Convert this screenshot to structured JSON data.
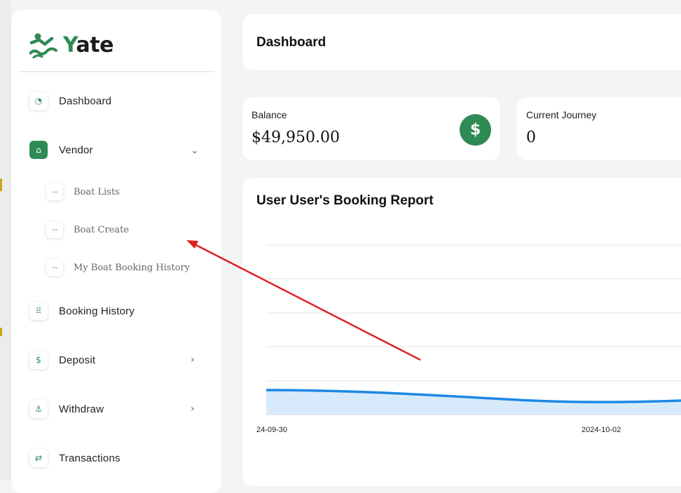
{
  "brand": {
    "name_first": "Y",
    "name_rest": "ate"
  },
  "sidebar": {
    "items": [
      {
        "label": "Dashboard",
        "icon": "gauge-icon"
      },
      {
        "label": "Vendor",
        "icon": "shop-icon",
        "expanded": true
      },
      {
        "label": "Booking History",
        "icon": "dots-grid-icon"
      },
      {
        "label": "Deposit",
        "icon": "dollar-icon"
      },
      {
        "label": "Withdraw",
        "icon": "hand-coin-icon"
      },
      {
        "label": "Transactions",
        "icon": "arrows-exchange-icon"
      }
    ],
    "vendor_subitems": [
      {
        "label": "Boat Lists"
      },
      {
        "label": "Boat Create"
      },
      {
        "label": "My Boat Booking History"
      }
    ]
  },
  "header": {
    "title": "Dashboard"
  },
  "stats": {
    "balance": {
      "label": "Balance",
      "value": "$49,950.00"
    },
    "current_journey": {
      "label": "Current Journey",
      "value": "0"
    }
  },
  "chart": {
    "title": "User User's Booking Report"
  },
  "chart_data": {
    "type": "area",
    "title": "User User's Booking Report",
    "x": [
      "2024-09-30",
      "2024-10-02"
    ],
    "tick_labels": [
      "24-09-30",
      "2024-10-02"
    ],
    "grid": true,
    "series_color": "#1e88e5",
    "fill_color": "#d7eafb"
  },
  "colors": {
    "accent": "#2f8a55",
    "annotation_arrow": "#e0201e"
  }
}
